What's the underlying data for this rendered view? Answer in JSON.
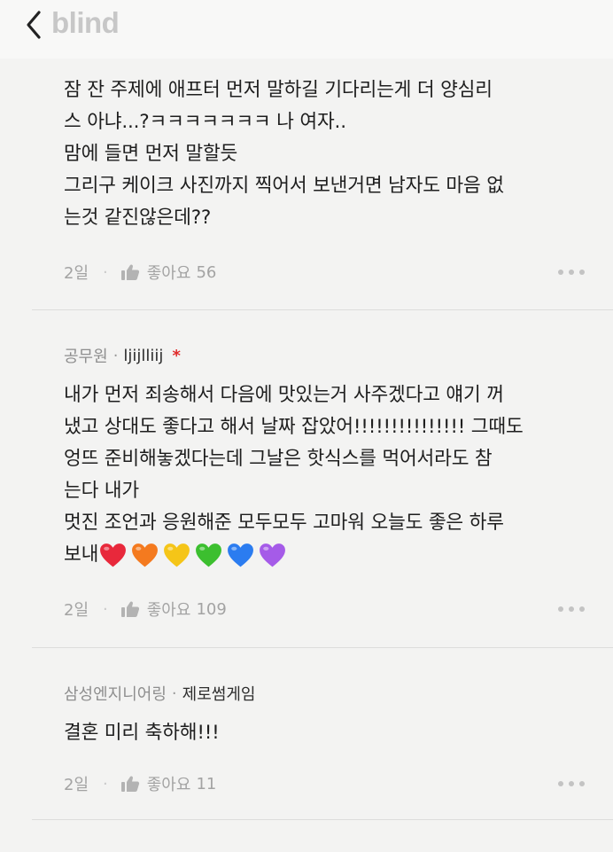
{
  "header": {
    "brand": "blind"
  },
  "comments": [
    {
      "body": "잠 잔 주제에 애프터 먼저 말하길 기다리는게 더 양심리\n스 아냐...?ㅋㅋㅋㅋㅋㅋㅋ 나 여자..\n맘에 들면 먼저 말할듯\n그리구 케이크 사진까지 찍어서 보낸거면 남자도 마음 없\n는것 같진않은데??",
      "time": "2일",
      "like_label": "좋아요",
      "like_count": "56"
    },
    {
      "company": "공무원",
      "nickname": "ljijlliij",
      "author_badge": "*",
      "body": "내가 먼저 죄송해서 다음에 맛있는거 사주겠다고 얘기 꺼\n냈고 상대도 좋다고 해서 날짜 잡았어!!!!!!!!!!!!!!! 그때도\n엉뜨 준비해놓겠다는데 그날은 핫식스를 먹어서라도 참\n는다 내가\n멋진 조언과 응원해준 모두모두 고마워 오늘도 좋은 하루\n보내",
      "hearts": [
        "#e8283b",
        "#f47a1f",
        "#f5c518",
        "#3cbf2f",
        "#2b7cf0",
        "#a55be8"
      ],
      "time": "2일",
      "like_label": "좋아요",
      "like_count": "109"
    },
    {
      "company": "삼성엔지니어링",
      "nickname": "제로썸게임",
      "body": "결혼 미리 축하해!!!",
      "time": "2일",
      "like_label": "좋아요",
      "like_count": "11"
    }
  ],
  "icons": {
    "back": "chevron-left-icon",
    "like": "thumbs-up-icon",
    "more": "more-horizontal-icon",
    "heart": "heart-icon"
  },
  "colors": {
    "background": "#f3f3f2",
    "meta_gray": "#8e8e8e",
    "badge_red": "#e02b2b"
  }
}
